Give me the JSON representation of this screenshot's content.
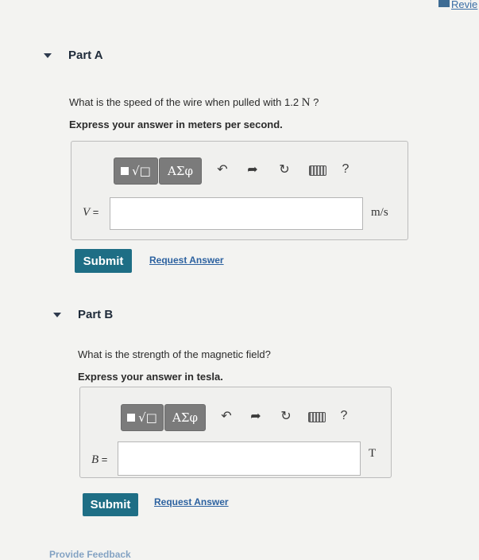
{
  "header": {
    "review_label": "Revie"
  },
  "part_a": {
    "title": "Part A",
    "question_text": "What is the speed of the wire when pulled with 1.2 ",
    "question_unit": "N",
    "question_end": " ?",
    "instruction": "Express your answer in meters per second.",
    "toolbar": {
      "templates_label": "√□",
      "greek_label": "ΑΣφ",
      "help_label": "?"
    },
    "variable": "V",
    "equals": " =",
    "input_value": "",
    "unit": "m/s",
    "submit_label": "Submit",
    "request_answer_label": "Request Answer"
  },
  "part_b": {
    "title": "Part B",
    "question_text": "What is the strength of the magnetic field?",
    "instruction": "Express your answer in tesla.",
    "toolbar": {
      "templates_label": "√□",
      "greek_label": "ΑΣφ",
      "help_label": "?"
    },
    "variable": "B",
    "equals": " =",
    "input_value": "",
    "unit": "T",
    "submit_label": "Submit",
    "request_answer_label": "Request Answer"
  },
  "footer": {
    "feedback_label": "Provide Feedback"
  }
}
